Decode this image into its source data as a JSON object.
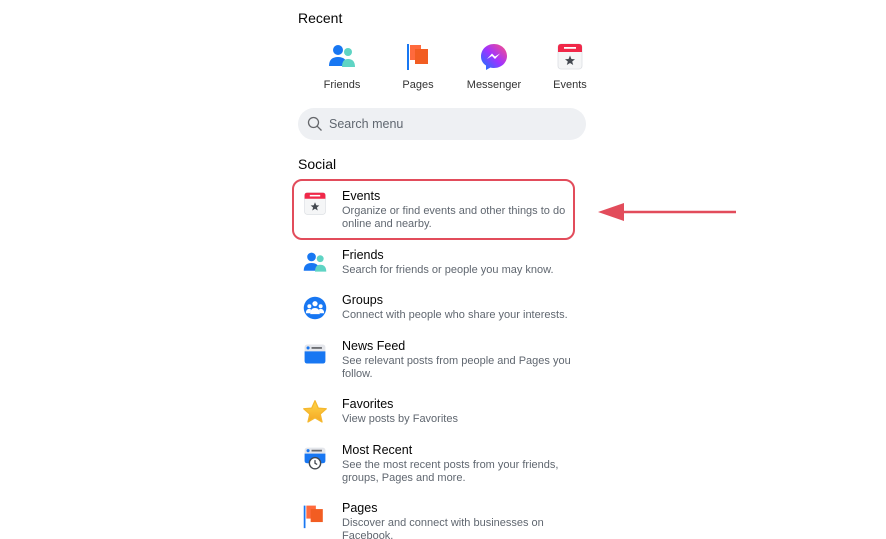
{
  "recent": {
    "title": "Recent",
    "items": [
      {
        "label": "Friends",
        "icon": "friends-icon"
      },
      {
        "label": "Pages",
        "icon": "pages-flag-icon"
      },
      {
        "label": "Messenger",
        "icon": "messenger-icon"
      },
      {
        "label": "Events",
        "icon": "events-calendar-icon"
      }
    ]
  },
  "search": {
    "placeholder": "Search menu",
    "value": ""
  },
  "social": {
    "title": "Social",
    "items": [
      {
        "name": "Events",
        "description": "Organize or find events and other things to do online and nearby.",
        "icon": "events-calendar-icon",
        "highlighted": true
      },
      {
        "name": "Friends",
        "description": "Search for friends or people you may know.",
        "icon": "friends-icon"
      },
      {
        "name": "Groups",
        "description": "Connect with people who share your interests.",
        "icon": "groups-icon"
      },
      {
        "name": "News Feed",
        "description": "See relevant posts from people and Pages you follow.",
        "icon": "news-feed-icon"
      },
      {
        "name": "Favorites",
        "description": "View posts by Favorites",
        "icon": "star-icon"
      },
      {
        "name": "Most Recent",
        "description": "See the most recent posts from your friends, groups, Pages and more.",
        "icon": "most-recent-clock-icon"
      },
      {
        "name": "Pages",
        "description": "Discover and connect with businesses on Facebook.",
        "icon": "pages-flag-icon"
      }
    ]
  },
  "annotation": {
    "color": "#e24c5b",
    "target": "Events"
  }
}
